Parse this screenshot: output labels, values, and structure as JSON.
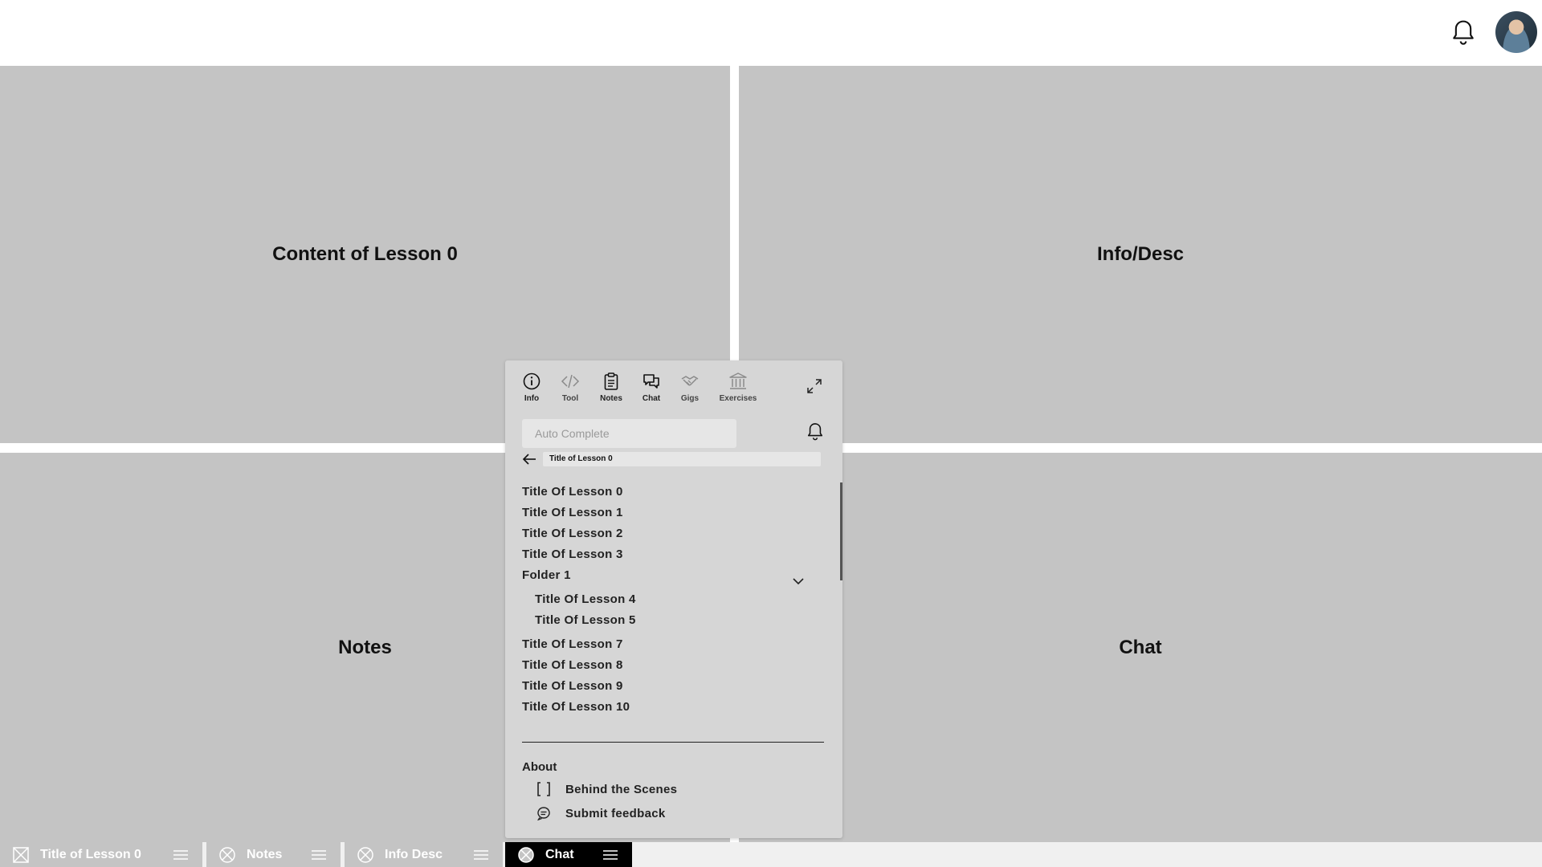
{
  "panels": {
    "top_left": "Content of Lesson 0",
    "top_right": "Info/Desc",
    "bottom_left": "Notes",
    "bottom_right": "Chat"
  },
  "popup": {
    "tabs": [
      {
        "label": "Info",
        "icon": "info-icon"
      },
      {
        "label": "Tool",
        "icon": "code-icon"
      },
      {
        "label": "Notes",
        "icon": "clipboard-icon"
      },
      {
        "label": "Chat",
        "icon": "chat-bubbles-icon"
      },
      {
        "label": "Gigs",
        "icon": "handshake-icon"
      },
      {
        "label": "Exercises",
        "icon": "bank-icon"
      }
    ],
    "search_placeholder": "Auto Complete",
    "breadcrumb": "Title of Lesson 0",
    "lessons": [
      "Title Of Lesson 0",
      "Title Of Lesson 1",
      "Title Of Lesson 2",
      "Title Of Lesson 3"
    ],
    "folder": {
      "label": "Folder 1",
      "items": [
        "Title Of Lesson 4",
        "Title Of Lesson 5"
      ]
    },
    "lessons_after": [
      "Title Of Lesson 7",
      "Title Of Lesson 8",
      "Title Of Lesson 9",
      "Title Of Lesson 10"
    ],
    "about": {
      "heading": "About",
      "links": [
        {
          "label": "Behind the Scenes",
          "icon": "brackets-icon"
        },
        {
          "label": "Submit feedback",
          "icon": "feedback-bubble-icon"
        }
      ]
    }
  },
  "taskbar": [
    {
      "label": "Title of Lesson 0",
      "active": false
    },
    {
      "label": "Notes",
      "active": false
    },
    {
      "label": "Info Desc",
      "active": false
    },
    {
      "label": "Chat",
      "active": true
    }
  ]
}
